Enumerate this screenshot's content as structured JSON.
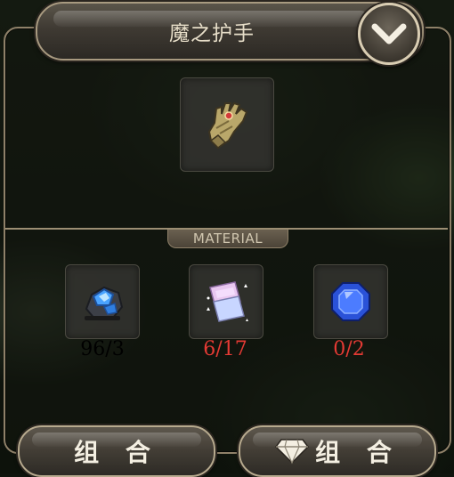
{
  "header": {
    "title": "魔之护手"
  },
  "result_item": {
    "name": "gauntlet",
    "icon": "gauntlet-icon"
  },
  "materials_section": {
    "label": "MATERIAL"
  },
  "materials": [
    {
      "icon": "blue-ore-icon",
      "count": "96/3",
      "sufficient": true
    },
    {
      "icon": "magic-scroll-icon",
      "count": "6/17",
      "sufficient": false
    },
    {
      "icon": "blue-gem-icon",
      "count": "0/2",
      "sufficient": false
    }
  ],
  "buttons": {
    "combine_label": "组 合",
    "gem_combine_label": "组 合"
  },
  "colors": {
    "sufficient": "#e8e3d6",
    "insufficient": "#e43a34",
    "frame": "#a89a80"
  }
}
